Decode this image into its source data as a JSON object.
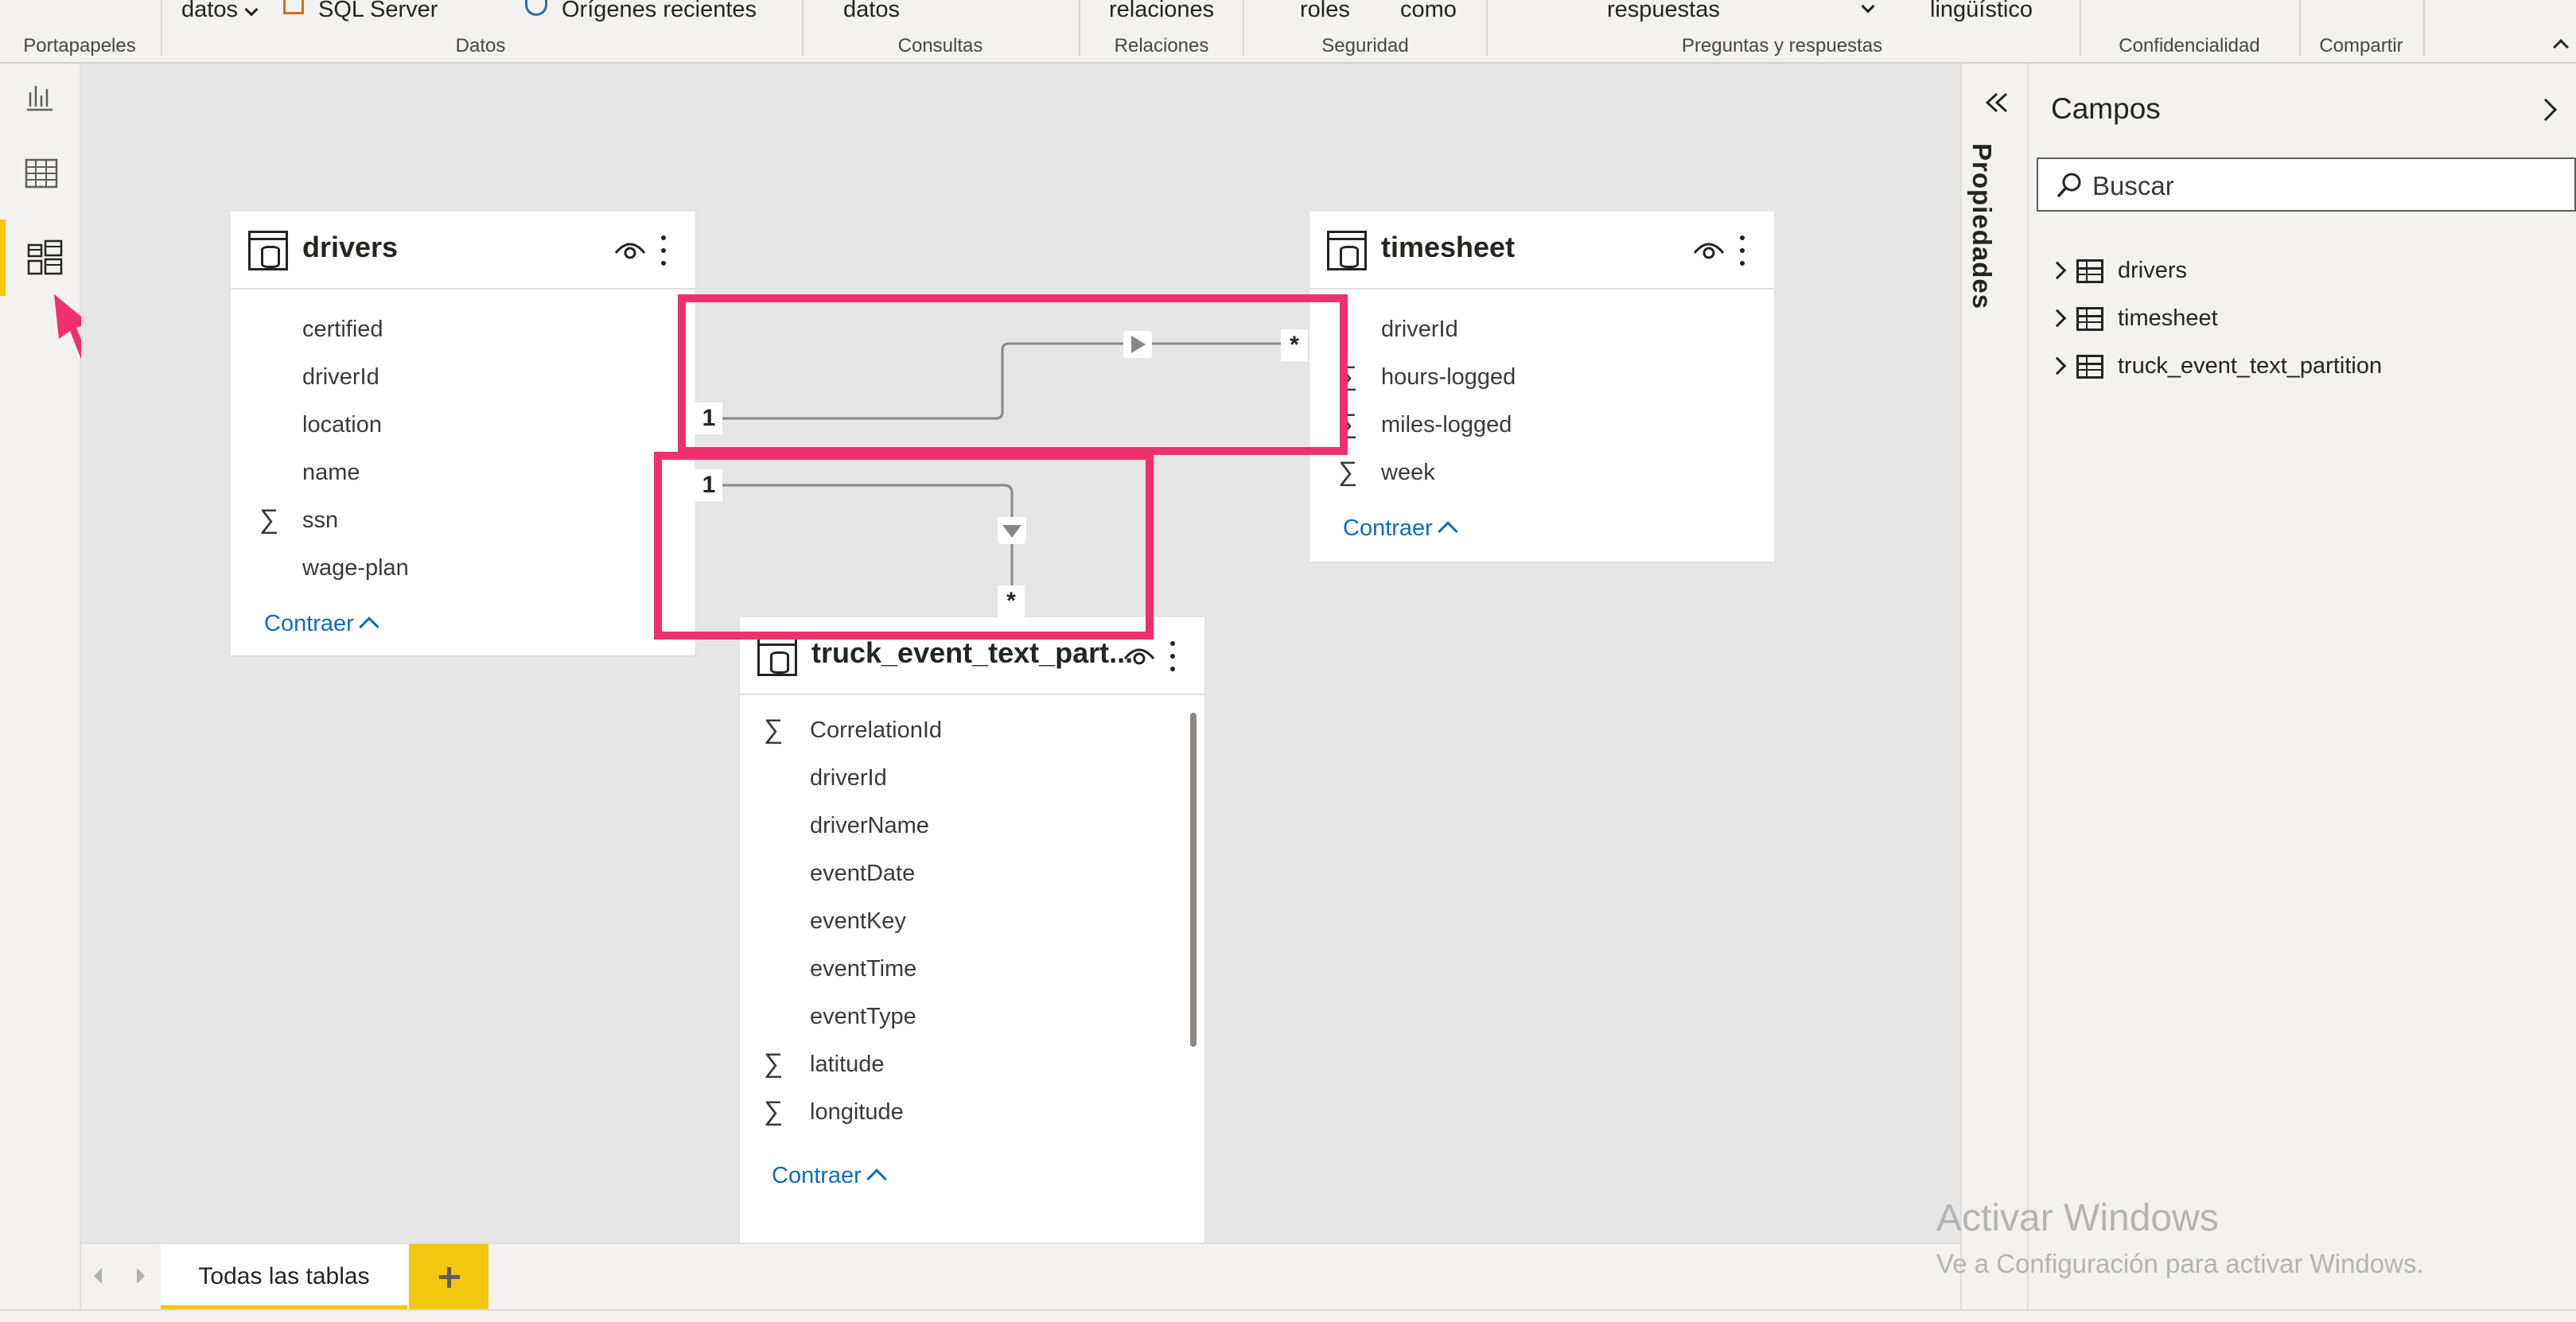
{
  "ribbon": {
    "items": [
      "datos",
      "SQL Server",
      "Orígenes recientes",
      "datos",
      "relaciones",
      "roles",
      "como",
      "respuestas",
      "lingüístico"
    ],
    "groups": [
      "Portapapeles",
      "Datos",
      "Consultas",
      "Relaciones",
      "Seguridad",
      "Preguntas y respuestas",
      "Confidencialidad",
      "Compartir"
    ]
  },
  "tables": {
    "drivers": {
      "title": "drivers",
      "fields": [
        "certified",
        "driverId",
        "location",
        "name",
        "ssn",
        "wage-plan"
      ],
      "collapse": "Contraer"
    },
    "timesheet": {
      "title": "timesheet",
      "fields": [
        "driverId",
        "hours-logged",
        "miles-logged",
        "week"
      ],
      "collapse": "Contraer"
    },
    "truck": {
      "title": "truck_event_text_part...",
      "fields": [
        "CorrelationId",
        "driverId",
        "driverName",
        "eventDate",
        "eventKey",
        "eventTime",
        "eventType",
        "latitude",
        "longitude"
      ],
      "collapse": "Contraer"
    }
  },
  "relationships": {
    "one": "1",
    "many": "*"
  },
  "bottom": {
    "tab_all": "Todas las tablas"
  },
  "properties": {
    "label": "Propiedades"
  },
  "fields_pane": {
    "title": "Campos",
    "search_placeholder": "Buscar",
    "items": [
      "drivers",
      "timesheet",
      "truck_event_text_partition"
    ]
  },
  "watermark": {
    "line1": "Activar Windows",
    "line2": "Ve a Configuración para activar Windows."
  },
  "colors": {
    "highlight": "#f0306e",
    "accent": "#f2c811",
    "link": "#0f6cbd"
  },
  "icons": [
    "report-view-icon",
    "data-view-icon",
    "model-view-icon",
    "eye-icon",
    "more-options-icon",
    "table-icon",
    "search-icon",
    "chevron-icon",
    "add-icon",
    "pointer-arrow"
  ]
}
